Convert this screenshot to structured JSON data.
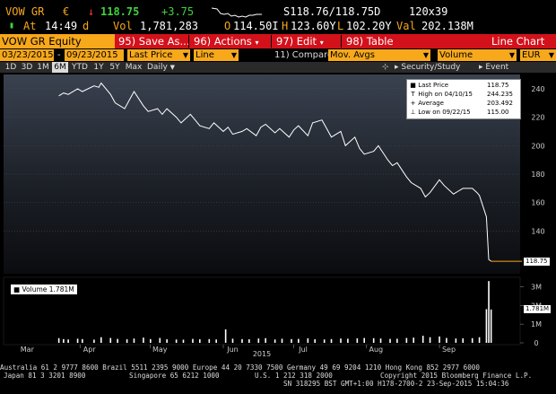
{
  "quote": {
    "ticker": "VOW GR",
    "currency": "€",
    "direction_arrow": "↓",
    "last_price": "118.75",
    "change": "+3.75",
    "bid_ask": "S118.76/118.75D",
    "size": "120x39",
    "at_label": "At",
    "time": "14:49",
    "time_suffix": "d",
    "vol_label": "Vol",
    "volume": "1,781,283",
    "open_label": "O",
    "open": "114.50I",
    "high_label": "H",
    "high": "123.60Y",
    "low_label": "L",
    "low": "102.20Y",
    "val_label": "Val",
    "value": "202.138M"
  },
  "command_bar": {
    "security": "VOW GR Equity",
    "items": [
      {
        "num": "95)",
        "label": "Save As..."
      },
      {
        "num": "96)",
        "label": "Actions"
      },
      {
        "num": "97)",
        "label": "Edit"
      },
      {
        "num": "98)",
        "label": "Table"
      }
    ],
    "function_name": "Line Chart"
  },
  "inputs": {
    "start_date": "03/23/2015",
    "dash": "-",
    "end_date": "09/23/2015",
    "field": "Last Price",
    "chart_style": "Line",
    "compare_label": "11) Compare",
    "compare_value": "Mov. Avgs",
    "lower_field": "Volume",
    "currency": "EUR"
  },
  "periods": {
    "buttons": [
      "1D",
      "3D",
      "1M",
      "6M",
      "YTD",
      "1Y",
      "5Y",
      "Max"
    ],
    "active": "6M",
    "frequency": "Daily",
    "security_study": "Security/Study",
    "event": "Event"
  },
  "legend": {
    "rows": [
      {
        "marker": "■",
        "label": "Last Price",
        "value": "118.75"
      },
      {
        "marker": "T",
        "label": "High on 04/10/15",
        "value": "244.235"
      },
      {
        "marker": "+",
        "label": "Average",
        "value": "203.492"
      },
      {
        "marker": "⊥",
        "label": "Low on 09/22/15",
        "value": "115.00"
      }
    ]
  },
  "volume_legend": {
    "label": "Volume",
    "value": "1.781M"
  },
  "footer": {
    "line1": "Australia 61 2 9777 8600 Brazil 5511 2395 9000 Europe 44 20 7330 7500 Germany 49 69 9204 1210 Hong Kong 852 2977 6000",
    "line2_left": "Japan 81 3 3201 8900",
    "line2_mid": "Singapore 65 6212 1000",
    "line2_mid2": "U.S. 1 212 318 2000",
    "line2_right": "Copyright 2015 Bloomberg Finance L.P.",
    "line3": "SN 318295 BST  GMT+1:00 H178-2700-2 23-Sep-2015 15:04:36"
  },
  "colors": {
    "amber": "#f7a81b",
    "command_bar_red": "#d3111b",
    "price_line": "#ffffff",
    "last_price_marker": "#f7a81b",
    "volume_bars": "#ffffff"
  },
  "chart_data": [
    {
      "type": "line",
      "title": "",
      "xlabel": "2015",
      "ylabel": "",
      "ylim": [
        110,
        250
      ],
      "yticks": [
        140,
        160,
        180,
        200,
        220,
        240
      ],
      "months": [
        "Mar",
        "Apr",
        "May",
        "Jun",
        "Jul",
        "Aug",
        "Sep"
      ],
      "last_value_label": "118.75",
      "series": [
        {
          "name": "Last Price",
          "x": [
            "2015-03-23",
            "2015-03-25",
            "2015-03-27",
            "2015-03-31",
            "2015-04-02",
            "2015-04-07",
            "2015-04-09",
            "2015-04-10",
            "2015-04-14",
            "2015-04-16",
            "2015-04-20",
            "2015-04-22",
            "2015-04-24",
            "2015-04-28",
            "2015-04-30",
            "2015-05-04",
            "2015-05-06",
            "2015-05-08",
            "2015-05-12",
            "2015-05-14",
            "2015-05-18",
            "2015-05-20",
            "2015-05-22",
            "2015-05-26",
            "2015-05-28",
            "2015-06-01",
            "2015-06-03",
            "2015-06-05",
            "2015-06-09",
            "2015-06-11",
            "2015-06-15",
            "2015-06-17",
            "2015-06-19",
            "2015-06-23",
            "2015-06-25",
            "2015-06-29",
            "2015-07-01",
            "2015-07-03",
            "2015-07-07",
            "2015-07-09",
            "2015-07-13",
            "2015-07-15",
            "2015-07-17",
            "2015-07-21",
            "2015-07-23",
            "2015-07-27",
            "2015-07-29",
            "2015-07-31",
            "2015-08-04",
            "2015-08-06",
            "2015-08-10",
            "2015-08-12",
            "2015-08-14",
            "2015-08-18",
            "2015-08-20",
            "2015-08-24",
            "2015-08-26",
            "2015-08-28",
            "2015-09-01",
            "2015-09-03",
            "2015-09-07",
            "2015-09-09",
            "2015-09-11",
            "2015-09-15",
            "2015-09-17",
            "2015-09-18",
            "2015-09-21",
            "2015-09-22",
            "2015-09-23"
          ],
          "y": [
            235,
            237,
            236,
            240,
            238,
            242,
            241,
            244,
            236,
            230,
            226,
            232,
            238,
            228,
            224,
            226,
            222,
            226,
            220,
            216,
            222,
            218,
            214,
            212,
            216,
            210,
            213,
            208,
            210,
            212,
            207,
            213,
            215,
            209,
            212,
            206,
            211,
            214,
            207,
            216,
            218,
            212,
            206,
            210,
            200,
            206,
            198,
            194,
            196,
            200,
            190,
            186,
            188,
            178,
            174,
            170,
            164,
            167,
            176,
            172,
            166,
            168,
            170,
            170,
            167,
            165,
            150,
            120,
            118.75
          ]
        }
      ]
    },
    {
      "type": "bar",
      "title": "",
      "ylabel": "Volume",
      "ylim": [
        0,
        3500000
      ],
      "yticks_labels": [
        "0",
        "1M",
        "2M",
        "3M"
      ],
      "yticks": [
        0,
        1000000,
        2000000,
        3000000
      ],
      "last_value_label": "1.781M",
      "series": [
        {
          "name": "Volume",
          "x": [
            "2015-03-23",
            "2015-03-25",
            "2015-03-27",
            "2015-03-31",
            "2015-04-02",
            "2015-04-07",
            "2015-04-10",
            "2015-04-14",
            "2015-04-17",
            "2015-04-21",
            "2015-04-24",
            "2015-04-28",
            "2015-05-01",
            "2015-05-05",
            "2015-05-08",
            "2015-05-12",
            "2015-05-15",
            "2015-05-19",
            "2015-05-22",
            "2015-05-26",
            "2015-05-29",
            "2015-06-02",
            "2015-06-05",
            "2015-06-09",
            "2015-06-12",
            "2015-06-16",
            "2015-06-19",
            "2015-06-23",
            "2015-06-26",
            "2015-06-30",
            "2015-07-03",
            "2015-07-07",
            "2015-07-10",
            "2015-07-14",
            "2015-07-17",
            "2015-07-21",
            "2015-07-24",
            "2015-07-28",
            "2015-07-31",
            "2015-08-04",
            "2015-08-07",
            "2015-08-11",
            "2015-08-14",
            "2015-08-18",
            "2015-08-21",
            "2015-08-25",
            "2015-08-28",
            "2015-09-01",
            "2015-09-04",
            "2015-09-08",
            "2015-09-11",
            "2015-09-15",
            "2015-09-18",
            "2015-09-21",
            "2015-09-22",
            "2015-09-23"
          ],
          "y": [
            250000,
            200000,
            180000,
            220000,
            200000,
            170000,
            300000,
            260000,
            210000,
            190000,
            230000,
            280000,
            200000,
            260000,
            190000,
            180000,
            170000,
            210000,
            190000,
            200000,
            180000,
            720000,
            220000,
            200000,
            190000,
            230000,
            250000,
            180000,
            220000,
            200000,
            210000,
            240000,
            190000,
            180000,
            200000,
            230000,
            220000,
            240000,
            260000,
            250000,
            230000,
            210000,
            220000,
            260000,
            280000,
            380000,
            300000,
            340000,
            260000,
            230000,
            240000,
            250000,
            300000,
            1800000,
            3300000,
            1781283
          ]
        }
      ]
    }
  ]
}
